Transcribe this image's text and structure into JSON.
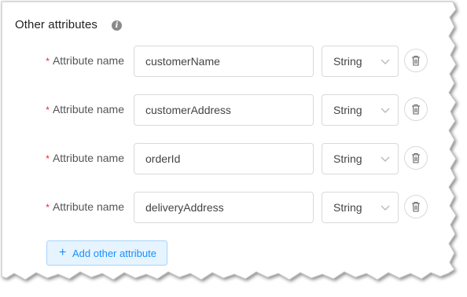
{
  "section": {
    "title": "Other attributes",
    "info_icon": "info-icon"
  },
  "attributes": [
    {
      "required_mark": "*",
      "label": "Attribute name",
      "name": "customerName",
      "type": "String"
    },
    {
      "required_mark": "*",
      "label": "Attribute name",
      "name": "customerAddress",
      "type": "String"
    },
    {
      "required_mark": "*",
      "label": "Attribute name",
      "name": "orderId",
      "type": "String"
    },
    {
      "required_mark": "*",
      "label": "Attribute name",
      "name": "deliveryAddress",
      "type": "String"
    }
  ],
  "add_button": {
    "icon": "plus-icon",
    "label": "Add other attribute"
  },
  "colors": {
    "accent": "#1890ff",
    "required": "#f5222d",
    "border": "#d9d9d9"
  }
}
